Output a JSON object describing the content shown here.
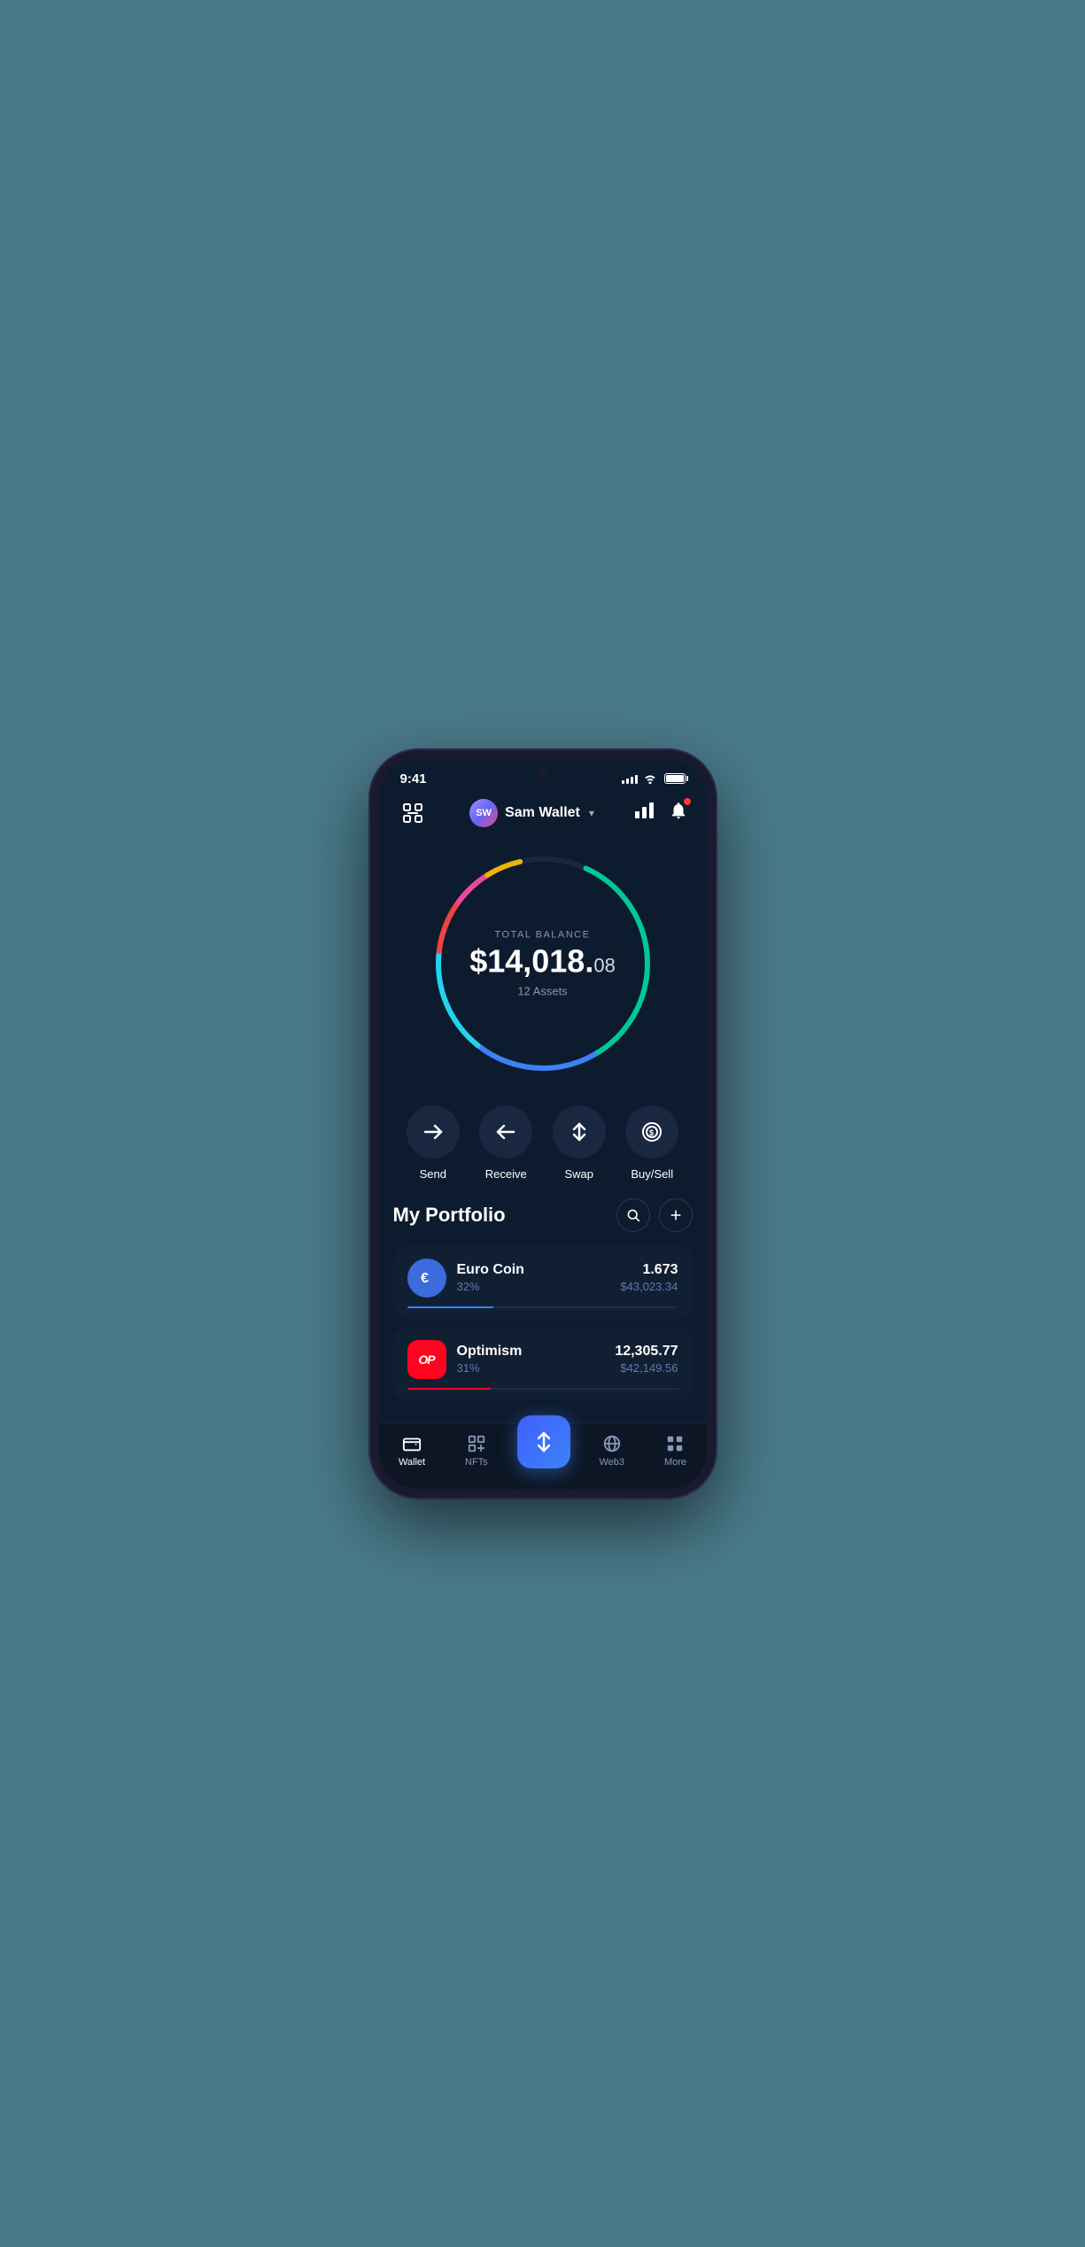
{
  "status": {
    "time": "9:41",
    "signal_bars": [
      4,
      6,
      8,
      10,
      12
    ],
    "battery_pct": 100
  },
  "header": {
    "scan_icon": "⊡",
    "avatar_initials": "SW",
    "wallet_name": "Sam Wallet",
    "dropdown_label": "▾"
  },
  "balance": {
    "label": "TOTAL BALANCE",
    "amount_main": "$14,018.",
    "amount_cents": "08",
    "assets_label": "12 Assets"
  },
  "actions": [
    {
      "id": "send",
      "icon": "→",
      "label": "Send"
    },
    {
      "id": "receive",
      "icon": "←",
      "label": "Receive"
    },
    {
      "id": "swap",
      "icon": "⇅",
      "label": "Swap"
    },
    {
      "id": "buysell",
      "icon": "⊙",
      "label": "Buy/Sell"
    }
  ],
  "portfolio": {
    "title": "My Portfolio",
    "search_icon": "🔍",
    "add_icon": "+",
    "assets": [
      {
        "id": "eurocoin",
        "name": "Euro Coin",
        "percentage": "32%",
        "amount": "1.673",
        "value": "$43,023.34",
        "progress": 32,
        "icon_text": "€",
        "icon_color": "#3b6bdc"
      },
      {
        "id": "optimism",
        "name": "Optimism",
        "percentage": "31%",
        "amount": "12,305.77",
        "value": "$42,149.56",
        "progress": 31,
        "icon_text": "OP",
        "icon_color": "#ff0420"
      }
    ]
  },
  "nav": {
    "items": [
      {
        "id": "wallet",
        "label": "Wallet",
        "icon": "👛",
        "active": true
      },
      {
        "id": "nfts",
        "label": "NFTs",
        "icon": "🖼",
        "active": false
      },
      {
        "id": "center",
        "label": "",
        "icon": "⇅",
        "active": false
      },
      {
        "id": "web3",
        "label": "Web3",
        "icon": "🌐",
        "active": false
      },
      {
        "id": "more",
        "label": "More",
        "icon": "⊞",
        "active": false
      }
    ]
  }
}
